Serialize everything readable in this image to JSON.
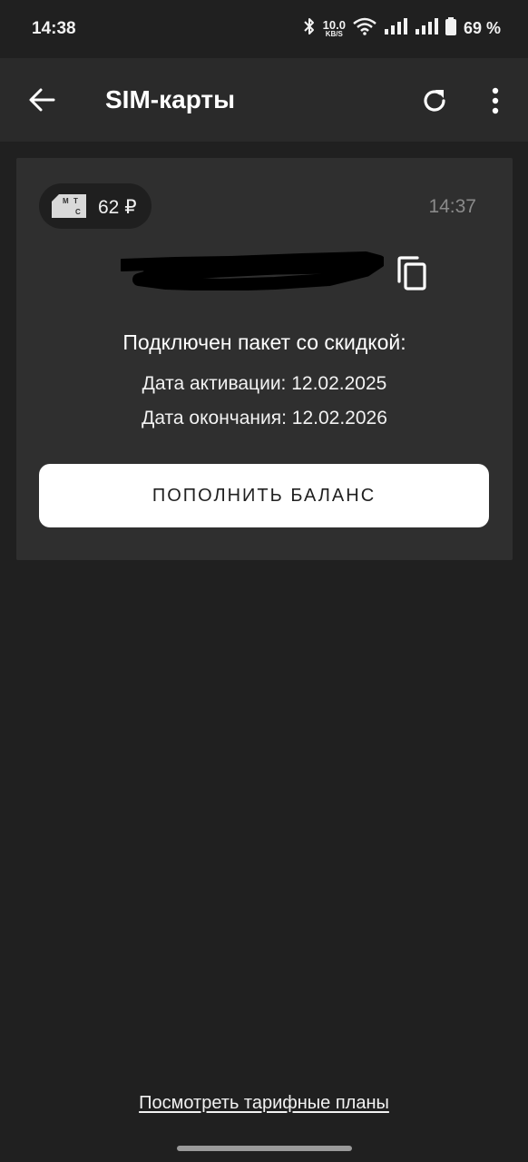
{
  "status_bar": {
    "time": "14:38",
    "net_speed_value": "10.0",
    "net_speed_unit": "KB/S",
    "battery_percent": "69 %",
    "icons": [
      "bluetooth-icon",
      "wifi-icon",
      "signal-icon",
      "signal-icon",
      "battery-icon"
    ]
  },
  "app_bar": {
    "title": "SIM-карты",
    "icons": [
      "back-arrow-icon",
      "refresh-icon",
      "more-vert-icon"
    ]
  },
  "sim_card": {
    "operator_logo_text": "М Т С",
    "balance": "62 ₽",
    "time": "14:37",
    "package_title": "Подключен пакет со скидкой:",
    "activation_date": "Дата активации: 12.02.2025",
    "end_date": "Дата окончания: 12.02.2026",
    "topup_button": "ПОПОЛНИТЬ БАЛАНС"
  },
  "footer": {
    "tariff_link": "Посмотреть тарифные планы"
  },
  "colors": {
    "background": "#202020",
    "app_bar": "#2a2a2a",
    "card": "#2f2f2f",
    "button": "#ffffff",
    "muted_text": "#8a8a8a"
  }
}
